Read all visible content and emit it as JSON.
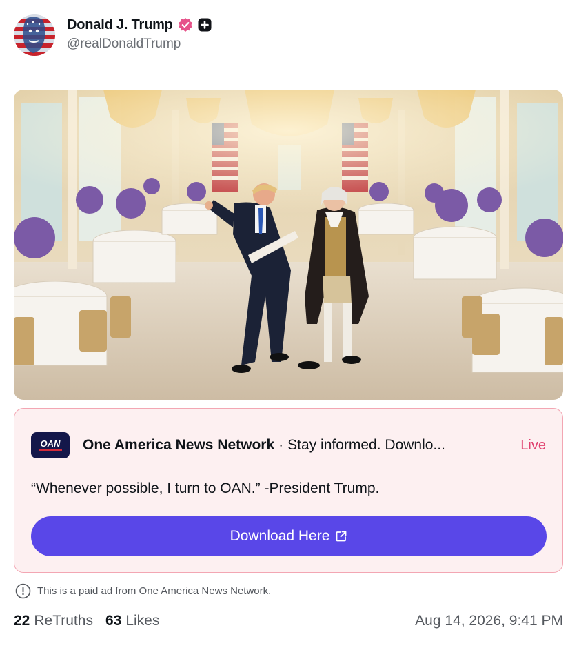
{
  "author": {
    "display_name": "Donald J. Trump",
    "handle": "@realDonaldTrump",
    "avatar": "avatar-flag-portrait",
    "verified_icon": "verified-badge-icon",
    "plus_icon": "plus-badge-icon"
  },
  "post": {
    "image": "photo-ballroom-two-men-walking"
  },
  "ad": {
    "logo_text": "OAN",
    "sponsor": "One America News Network",
    "separator": "·",
    "tagline": "Stay informed. Downlo...",
    "live_label": "Live",
    "quote": "“Whenever possible, I turn to OAN.” -President Trump.",
    "button_label": "Download Here",
    "button_icon": "external-link-icon",
    "colors": {
      "accent": "#5947e8",
      "live": "#e0416f",
      "card_bg": "#fdf0f1",
      "card_border": "#f3a6b3"
    }
  },
  "disclaimer": {
    "icon": "info-icon",
    "text": "This is a paid ad from One America News Network."
  },
  "stats": {
    "retruths_count": "22",
    "retruths_label": "ReTruths",
    "likes_count": "63",
    "likes_label": "Likes",
    "timestamp": "Aug 14, 2026, 9:41 PM"
  }
}
